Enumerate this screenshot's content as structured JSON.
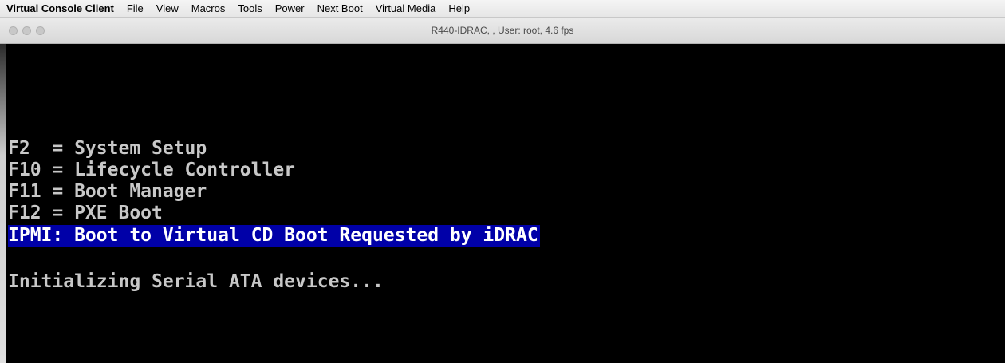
{
  "menubar": {
    "app_name": "Virtual Console Client",
    "items": [
      "File",
      "View",
      "Macros",
      "Tools",
      "Power",
      "Next Boot",
      "Virtual Media",
      "Help"
    ]
  },
  "window": {
    "title": "R440-IDRAC,  , User: root, 4.6 fps"
  },
  "console": {
    "lines": [
      "F2  = System Setup",
      "F10 = Lifecycle Controller",
      "F11 = Boot Manager",
      "F12 = PXE Boot",
      "IPMI: Boot to Virtual CD Boot Requested by iDRAC",
      "Initializing Serial ATA devices..."
    ],
    "highlight_color": "#0000a8",
    "background_color": "#000000",
    "text_color": "#c8c8c8"
  }
}
